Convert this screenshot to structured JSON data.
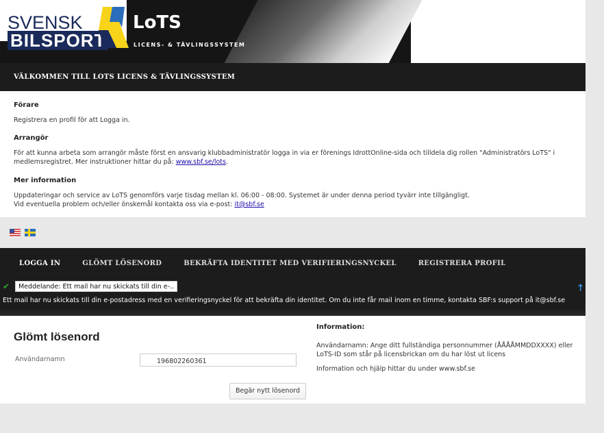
{
  "header": {
    "logo_svensk": "SVENSK",
    "logo_bilsport": "BILSPORT",
    "title": "LoTS",
    "subtitle": "LICENS- & TÄVLINGSSYSTEM"
  },
  "welcome": {
    "title": "VÄLKOMMEN TILL LOTS LICENS & TÄVLINGSSYSTEM"
  },
  "info": {
    "forare_heading": "Förare",
    "forare_text": "Registrera en profil för att Logga in.",
    "arrangor_heading": "Arrangör",
    "arrangor_text": "För att kunna arbeta som arrangör måste först en ansvarig klubbadministratör logga in via er förenings IdrottOnline-sida och tilldela dig rollen \"Administratörs LoTS\" i medlemsregistret. Mer instruktioner hittar du på: ",
    "arrangor_link": "www.sbf.se/lots",
    "arrangor_end": ".",
    "mer_heading": "Mer information",
    "mer_text1": "Uppdateringar och service av LoTS genomförs varje tisdag mellan kl. 06:00 - 08:00. Systemet är under denna period tyvärr inte tillgängligt.",
    "mer_text2": "Vid eventuella problem och/eller önskemål kontakta oss via e-post: ",
    "mer_link": "it@sbf.se"
  },
  "flags": {
    "english": "flag-us-icon",
    "swedish": "flag-se-icon"
  },
  "nav": {
    "items": [
      "LOGGA IN",
      "GLÖMT LÖSENORD",
      "BEKRÄFTA IDENTITET MED VERIFIERINGSNYCKEL",
      "REGISTRERA PROFIL"
    ]
  },
  "notice": {
    "toast": "Meddelande: Ett mail har nu skickats till din e-..",
    "message": "Ett mail har nu skickats till din e-postadress med en verifieringsnyckel för att bekräfta din identitet. Om du inte får mail inom en timme, kontakta SBF:s support på it@sbf.se",
    "check_icon": "✔",
    "arrow_icon": "🡑"
  },
  "form": {
    "title": "Glömt lösenord",
    "username_label": "Användarnamn",
    "username_value": "196802260361",
    "submit_label": "Begär nytt lösenord"
  },
  "side_info": {
    "heading": "Information:",
    "text1": "Användarnamn: Ange ditt fullständiga personnummer (ÅÅÅÅMMDDXXXX) eller LoTS-ID som står på licensbrickan om du har löst ut licens",
    "text2": "Information och hjälp hittar du under www.sbf.se"
  },
  "colors": {
    "dark_bar": "#1c1c1c",
    "brand_navy": "#1a2a5a",
    "brand_yellow": "#f7d31a",
    "brand_blue": "#2a6ebb",
    "check_green": "#2aa52a",
    "arrow_blue": "#3aa0ff"
  }
}
